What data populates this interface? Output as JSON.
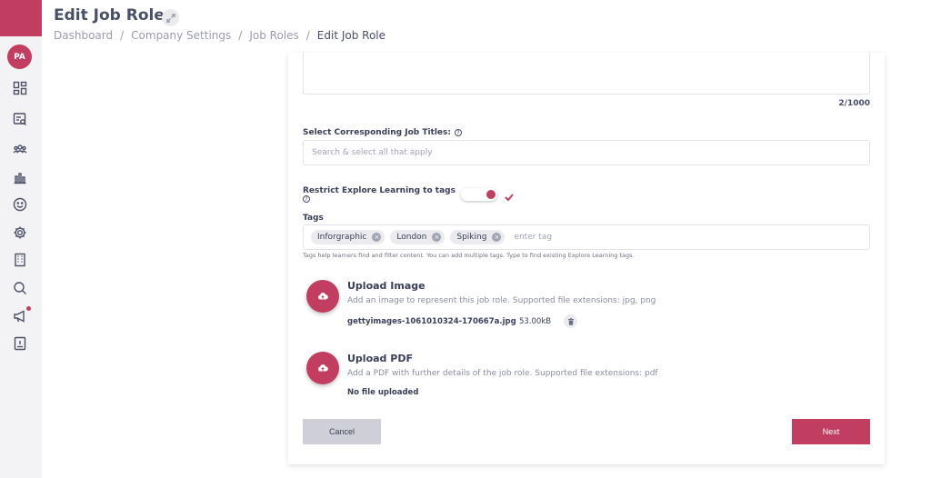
{
  "sidebar": {
    "avatar_initials": "PA",
    "icons": [
      "dashboard-icon",
      "search-list-icon",
      "users-icon",
      "bar-chart-icon",
      "smiley-icon",
      "gear-icon",
      "building-icon",
      "search-icon",
      "megaphone-icon",
      "id-card-icon"
    ],
    "accent_color": "#c23e60"
  },
  "header": {
    "title": "Edit Job Role",
    "breadcrumb": {
      "items": [
        "Dashboard",
        "Company Settings",
        "Job Roles",
        "Edit Job Role"
      ],
      "separator": "/"
    }
  },
  "form": {
    "description_count": "2/1000",
    "job_titles": {
      "label": "Select Corresponding Job Titles:",
      "placeholder": "Search & select all that apply"
    },
    "restrict": {
      "label": "Restrict Explore Learning to tags",
      "enabled": true
    },
    "tags": {
      "label": "Tags",
      "items": [
        "Inforgraphic",
        "London",
        "Spiking"
      ],
      "placeholder": "enter tag",
      "help": "Tags help learners find and filter content. You can add multiple tags. Type to find existing Explore Learning tags."
    },
    "upload_image": {
      "title": "Upload Image",
      "description": "Add an image to represent this job role. Supported file extensions: jpg, png",
      "file_name": "gettyimages-1061010324-170667a.jpg",
      "file_size": "53.00kB"
    },
    "upload_pdf": {
      "title": "Upload PDF",
      "description": "Add a PDF with further details of the job role. Supported file extensions: pdf",
      "status": "No file uploaded"
    },
    "cancel_label": "Cancel",
    "next_label": "Next"
  }
}
